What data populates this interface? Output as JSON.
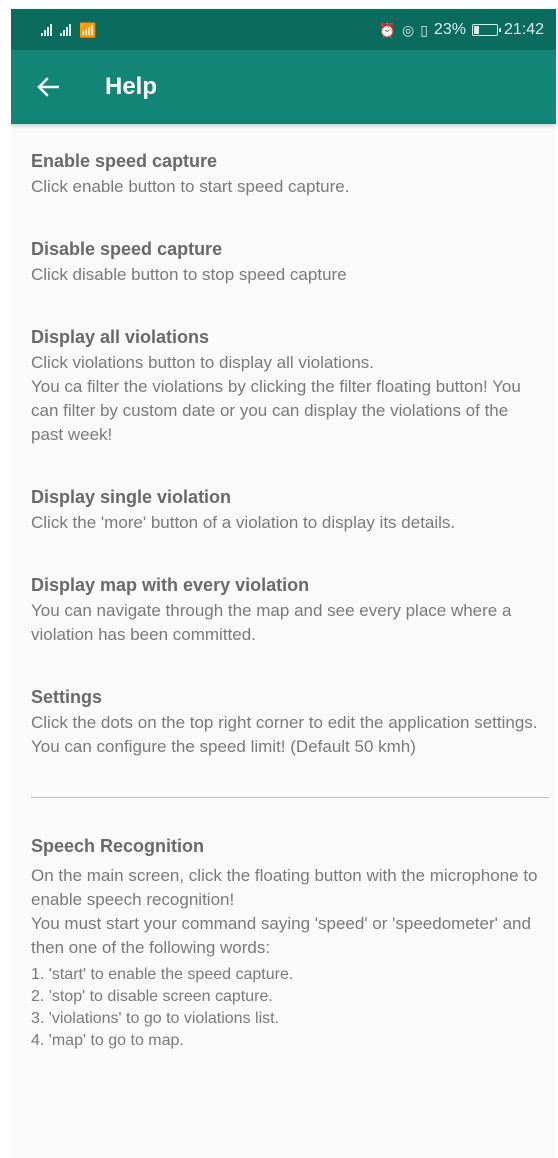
{
  "status_bar": {
    "time": "21:42",
    "battery": "23%"
  },
  "app_bar": {
    "title": "Help"
  },
  "sections": [
    {
      "title": "Enable speed capture",
      "lines": [
        "Click enable button to start speed capture."
      ]
    },
    {
      "title": "Disable speed capture",
      "lines": [
        "Click disable button to stop speed capture"
      ]
    },
    {
      "title": "Display all violations",
      "lines": [
        "Click violations button to display all violations.",
        "You ca filter the violations by clicking the filter floating button! You can filter by custom date or you can display the violations of the past week!"
      ]
    },
    {
      "title": "Display single violation",
      "lines": [
        "Click the 'more' button of a violation to display its details."
      ]
    },
    {
      "title": "Display map with every violation",
      "lines": [
        "You can navigate through the map and see every place where a violation has been committed."
      ]
    },
    {
      "title": "Settings",
      "lines": [
        "Click the dots on the top right corner to edit the application settings.",
        "You can configure the speed limit! (Default 50 kmh)"
      ]
    }
  ],
  "speech": {
    "title": "Speech Recognition",
    "lines": [
      "On the main screen, click the floating button with the microphone to enable speech recognition!",
      "You must start your command saying 'speed' or 'speedometer' and then one of the following words:"
    ],
    "list": [
      "1. 'start' to enable the speed capture.",
      "2. 'stop' to disable screen capture.",
      "3. 'violations' to go to violations list.",
      "4. 'map' to go to map."
    ]
  }
}
